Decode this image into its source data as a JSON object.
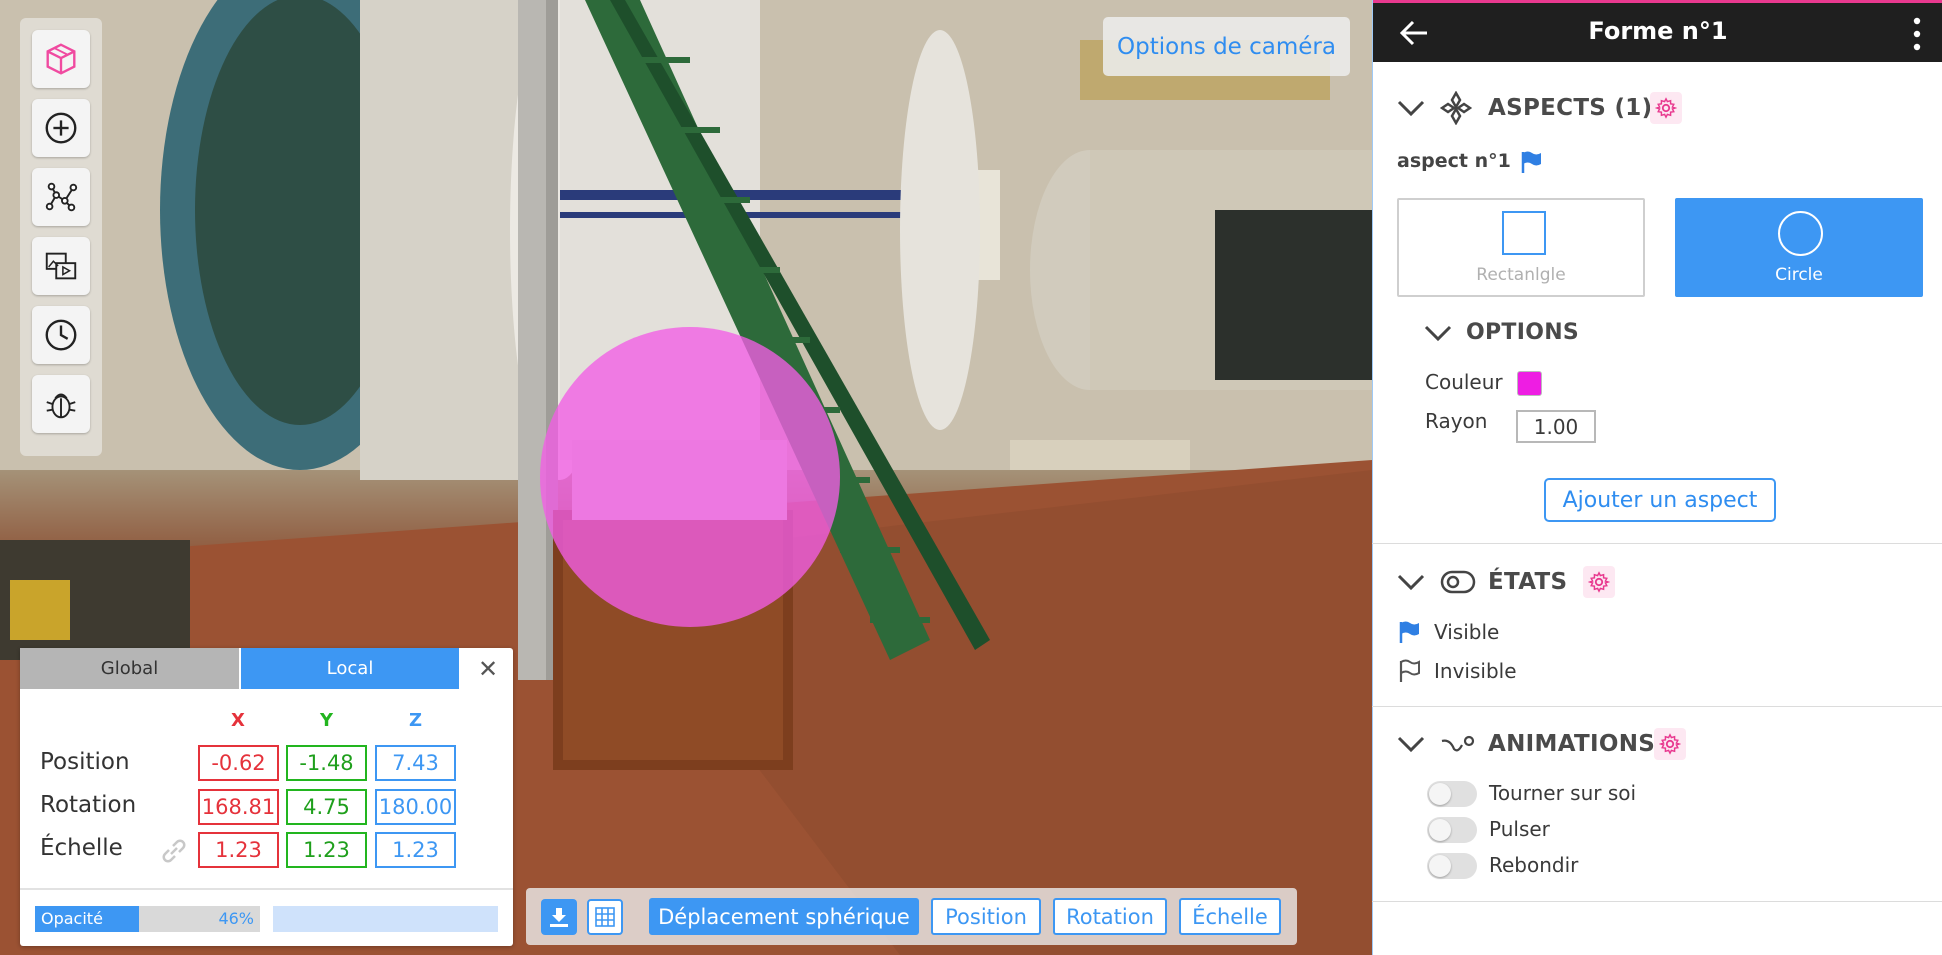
{
  "viewport": {
    "camera_options_label": "Options de caméra",
    "toolbar_icons": [
      "cube-icon",
      "add-circle-icon",
      "graph-nodes-icon",
      "media-gallery-icon",
      "clock-icon",
      "bug-icon"
    ]
  },
  "transform_panel": {
    "tabs": {
      "global": "Global",
      "local": "Local",
      "active": "Local"
    },
    "close_symbol": "✕",
    "axes": {
      "x": "X",
      "y": "Y",
      "z": "Z"
    },
    "rows": {
      "position": {
        "label": "Position",
        "x": "-0.62",
        "y": "-1.48",
        "z": "7.43"
      },
      "rotation": {
        "label": "Rotation",
        "x": "168.81",
        "y": "4.75",
        "z": "180.00"
      },
      "scale": {
        "label": "Échelle",
        "x": "1.23",
        "y": "1.23",
        "z": "1.23"
      }
    },
    "opacity": {
      "label": "Opacité",
      "value_text": "46%",
      "fraction": 0.46
    },
    "axis_colors": {
      "x": "#e5323b",
      "y": "#22b51f",
      "z": "#3d97f3"
    }
  },
  "bottom_toolbar": {
    "modes": [
      "Déplacement sphérique",
      "Position",
      "Rotation",
      "Échelle"
    ],
    "active_mode": "Déplacement sphérique"
  },
  "inspector": {
    "title": "Forme n°1",
    "aspects": {
      "title": "ASPECTS (1)",
      "aspect_name": "aspect n°1",
      "shapes": {
        "rectangle": "Rectanlgle",
        "circle": "Circle",
        "selected": "Circle"
      },
      "options": {
        "title": "OPTIONS",
        "color_label": "Couleur",
        "color_value": "#ee1de3",
        "radius_label": "Rayon",
        "radius_value": "1.00"
      },
      "add_button": "Ajouter un aspect"
    },
    "states": {
      "title": "ÉTATS",
      "items": [
        "Visible",
        "Invisible"
      ]
    },
    "animations": {
      "title": "ANIMATIONS",
      "items": [
        "Tourner sur soi",
        "Pulser",
        "Rebondir"
      ]
    },
    "accent_color": "#3d97f3",
    "settings_color": "#e8398f"
  }
}
